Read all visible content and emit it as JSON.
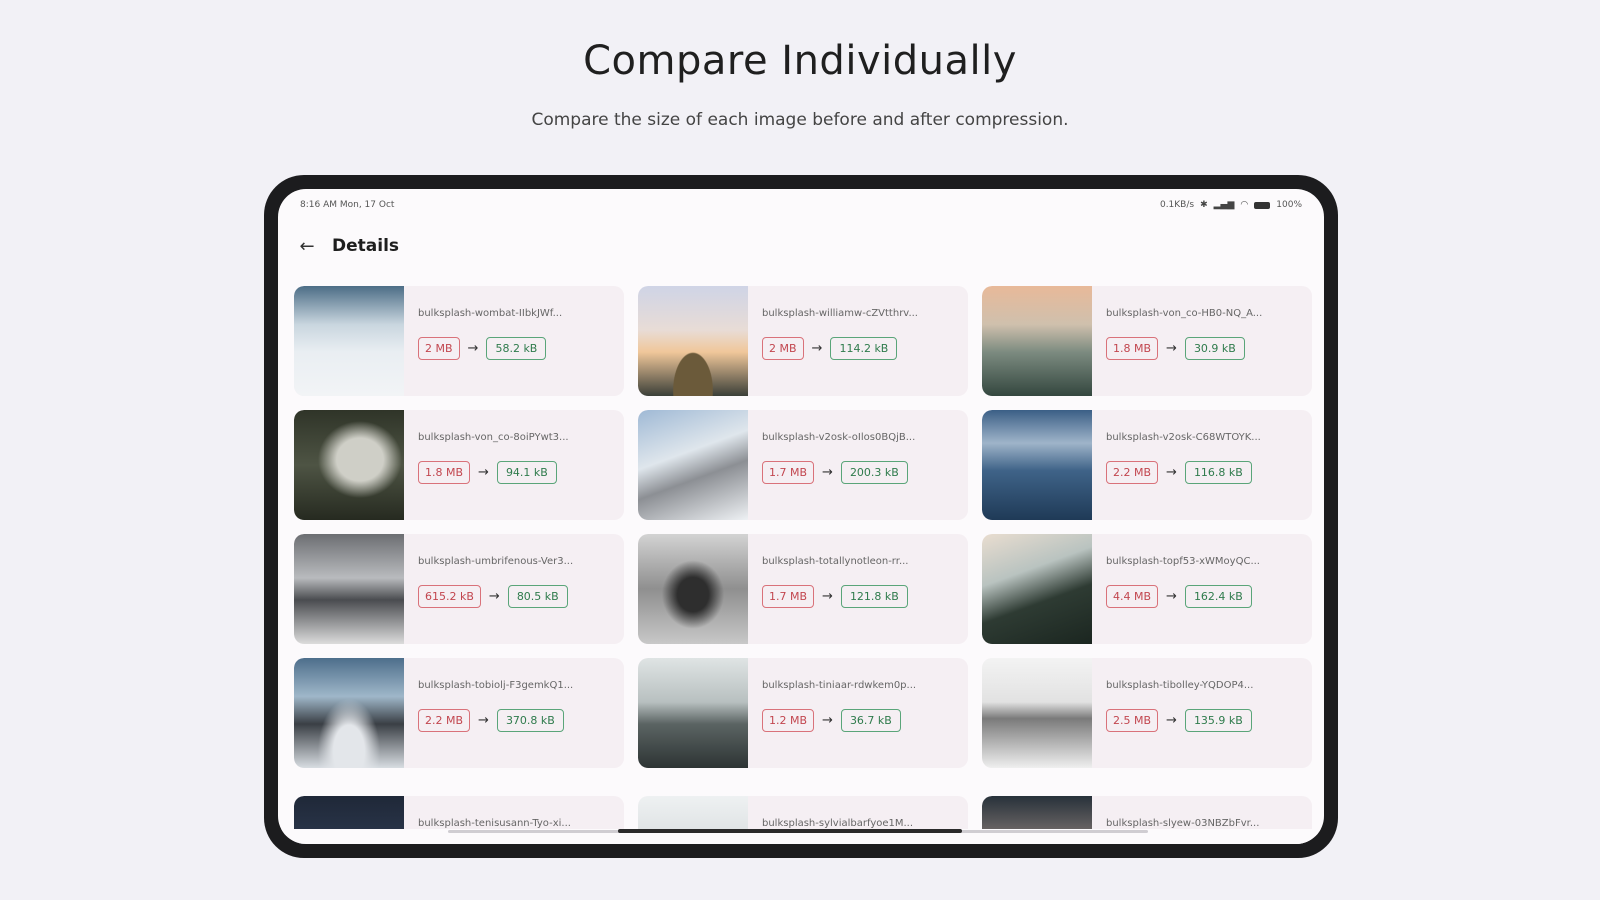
{
  "hero": {
    "title": "Compare Individually",
    "subtitle": "Compare the size of each image before and after compression."
  },
  "status_bar": {
    "time_date": "8:16 AM  Mon, 17 Oct",
    "network_speed": "0.1KB/s",
    "battery": "100%"
  },
  "app_bar": {
    "back_icon": "arrow-left-icon",
    "title": "Details"
  },
  "items": [
    {
      "file": "bulksplash-wombat-IIbkJWf...",
      "before": "2 MB",
      "after": "58.2 kB",
      "thumb": "t1"
    },
    {
      "file": "bulksplash-williamw-cZVtthrv...",
      "before": "2 MB",
      "after": "114.2 kB",
      "thumb": "t2"
    },
    {
      "file": "bulksplash-von_co-HB0-NQ_A...",
      "before": "1.8 MB",
      "after": "30.9 kB",
      "thumb": "t3"
    },
    {
      "file": "bulksplash-von_co-8oiPYwt3...",
      "before": "1.8 MB",
      "after": "94.1 kB",
      "thumb": "t4"
    },
    {
      "file": "bulksplash-v2osk-oIlos0BQjB...",
      "before": "1.7 MB",
      "after": "200.3 kB",
      "thumb": "t5"
    },
    {
      "file": "bulksplash-v2osk-C68WTOYK...",
      "before": "2.2 MB",
      "after": "116.8 kB",
      "thumb": "t6"
    },
    {
      "file": "bulksplash-umbrifenous-Ver3...",
      "before": "615.2 kB",
      "after": "80.5 kB",
      "thumb": "t7"
    },
    {
      "file": "bulksplash-totallynotleon-rr...",
      "before": "1.7 MB",
      "after": "121.8 kB",
      "thumb": "t8"
    },
    {
      "file": "bulksplash-topf53-xWMoyQC...",
      "before": "4.4 MB",
      "after": "162.4 kB",
      "thumb": "t9"
    },
    {
      "file": "bulksplash-tobiolj-F3gemkQ1...",
      "before": "2.2 MB",
      "after": "370.8 kB",
      "thumb": "t10"
    },
    {
      "file": "bulksplash-tiniaar-rdwkem0p...",
      "before": "1.2 MB",
      "after": "36.7 kB",
      "thumb": "t11"
    },
    {
      "file": "bulksplash-tibolley-YQDOP4...",
      "before": "2.5 MB",
      "after": "135.9 kB",
      "thumb": "t12"
    }
  ],
  "partial_items": [
    {
      "file": "bulksplash-tenisusann-Tyo-xi...",
      "thumb": "t13"
    },
    {
      "file": "bulksplash-sylvialbarfyoe1M...",
      "thumb": "t14"
    },
    {
      "file": "bulksplash-slyew-03NBZbFvr...",
      "thumb": "t15"
    }
  ],
  "arrow_glyph": "→",
  "colors": {
    "before_accent": "#c2464f",
    "after_accent": "#2f7b4c",
    "card_bg": "#f5eff3"
  }
}
